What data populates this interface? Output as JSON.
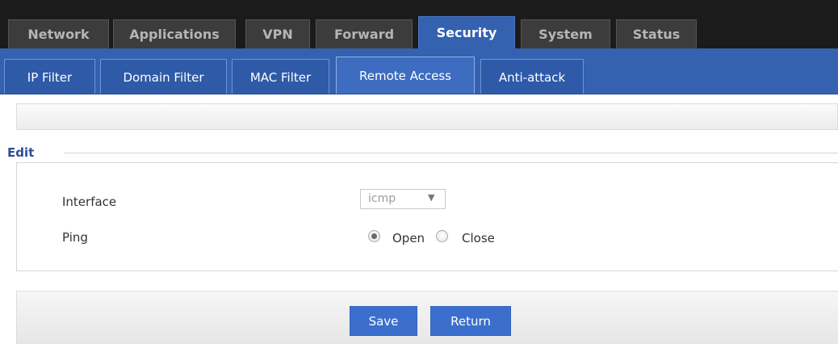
{
  "main_tabs": [
    {
      "label": "Network"
    },
    {
      "label": "Applications"
    },
    {
      "label": "VPN"
    },
    {
      "label": "Forward"
    },
    {
      "label": "Security",
      "active": true
    },
    {
      "label": "System"
    },
    {
      "label": "Status"
    }
  ],
  "sub_tabs": [
    {
      "label": "IP Filter"
    },
    {
      "label": "Domain Filter"
    },
    {
      "label": "MAC Filter"
    },
    {
      "label": "Remote Access",
      "active": true
    },
    {
      "label": "Anti-attack"
    }
  ],
  "edit": {
    "legend": "Edit",
    "interface": {
      "label": "Interface",
      "selected": "icmp"
    },
    "ping": {
      "label": "Ping",
      "options": [
        "Open",
        "Close"
      ],
      "selected": "Open"
    }
  },
  "actions": {
    "save_label": "Save",
    "return_label": "Return"
  },
  "colors": {
    "accent": "#3461b0",
    "button": "#3c6fcd",
    "top_bar": "#1b1b1b"
  }
}
